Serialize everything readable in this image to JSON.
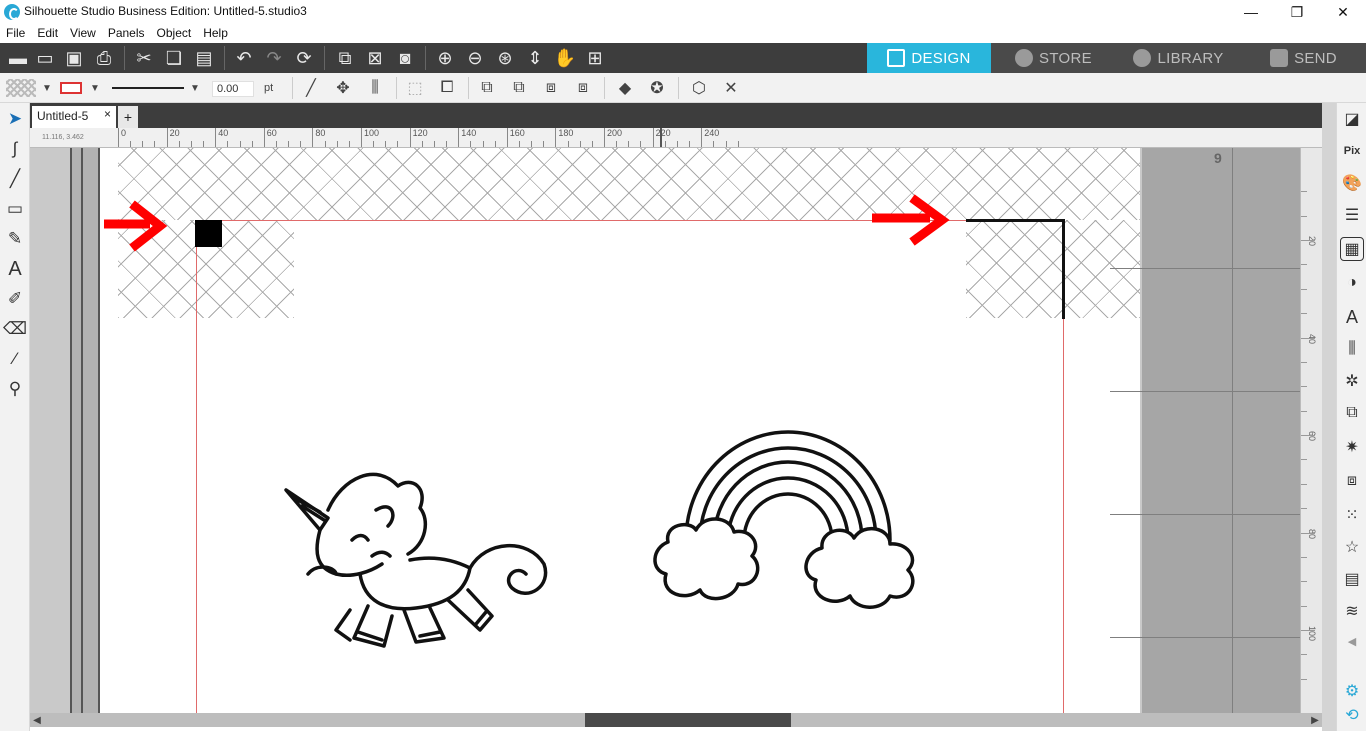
{
  "window": {
    "title": "Silhouette Studio Business Edition: Untitled-5.studio3",
    "minimize": "—",
    "restore": "❐",
    "close": "✕"
  },
  "menu": [
    "File",
    "Edit",
    "View",
    "Panels",
    "Object",
    "Help"
  ],
  "nav_tabs": {
    "design": "DESIGN",
    "store": "STORE",
    "library": "LIBRARY",
    "send": "SEND"
  },
  "line_settings": {
    "width_value": "0.00",
    "unit": "pt"
  },
  "document": {
    "tab_name": "Untitled-5",
    "tab_close": "×",
    "tab_add": "+"
  },
  "ruler": {
    "coordinate": "11.116, 3.462",
    "h_labels": [
      "0",
      "20",
      "40",
      "60",
      "80",
      "100",
      "120",
      "140",
      "160",
      "180",
      "200",
      "220",
      "240"
    ],
    "v_labels": [
      "20",
      "40",
      "60",
      "80",
      "100"
    ]
  },
  "page": {
    "number": "9"
  },
  "colors": {
    "accent": "#29b6dc",
    "toolbar_dark": "#3d3d3d",
    "annotation_arrow": "#ff0000",
    "cut_border": "#e06a6a"
  },
  "icons": {
    "toolbar": [
      "new-document-icon",
      "open-folder-icon",
      "save-icon",
      "print-icon",
      "cut-icon",
      "copy-icon",
      "paste-icon",
      "undo-icon",
      "redo-icon",
      "redraw-icon",
      "select-all-icon",
      "deselect-icon",
      "select-by-color-icon",
      "zoom-in-icon",
      "zoom-out-icon",
      "zoom-selected-icon",
      "drag-view-icon",
      "pan-hand-icon",
      "fit-to-page-icon"
    ],
    "left_tools": [
      "pointer-icon",
      "edit-points-icon",
      "line-tool-icon",
      "rectangle-tool-icon",
      "draw-tool-icon",
      "text-tool-icon",
      "sketch-tool-icon",
      "eraser-icon",
      "knife-icon",
      "eyedropper-icon"
    ],
    "right_panels": [
      "page-setup-icon",
      "pixscan-icon",
      "fill-color-icon",
      "line-style-icon",
      "registration-marks-icon",
      "contrast-icon",
      "text-style-icon",
      "align-icon",
      "transform-icon",
      "replicate-icon",
      "offset-icon",
      "trace-icon",
      "modify-icon",
      "scatter-icon",
      "star-icon",
      "layers-icon",
      "sketch-panel-icon",
      "settings-gear-icon",
      "refresh-icon"
    ]
  }
}
